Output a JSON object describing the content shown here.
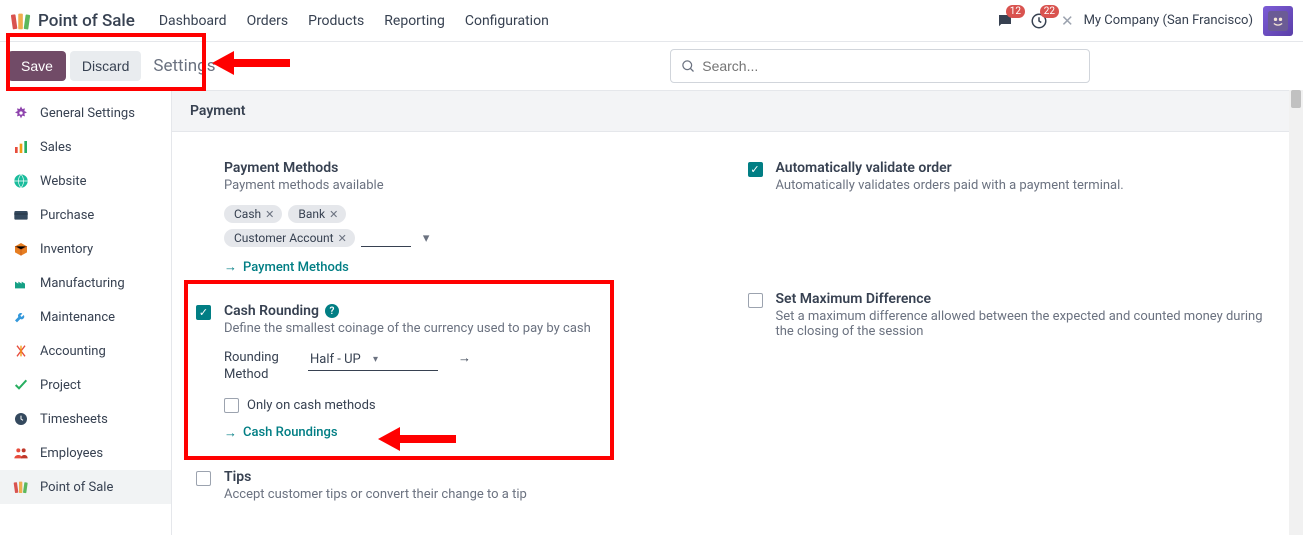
{
  "brand": {
    "title": "Point of Sale"
  },
  "nav": {
    "items": [
      "Dashboard",
      "Orders",
      "Products",
      "Reporting",
      "Configuration"
    ]
  },
  "nav_right": {
    "msg_badge": "12",
    "clock_badge": "22",
    "company": "My Company (San Francisco)"
  },
  "actions": {
    "save": "Save",
    "discard": "Discard",
    "breadcrumb": "Settings"
  },
  "search": {
    "placeholder": "Search..."
  },
  "sidebar": {
    "items": [
      {
        "label": "General Settings",
        "active": false
      },
      {
        "label": "Sales",
        "active": false
      },
      {
        "label": "Website",
        "active": false
      },
      {
        "label": "Purchase",
        "active": false
      },
      {
        "label": "Inventory",
        "active": false
      },
      {
        "label": "Manufacturing",
        "active": false
      },
      {
        "label": "Maintenance",
        "active": false
      },
      {
        "label": "Accounting",
        "active": false
      },
      {
        "label": "Project",
        "active": false
      },
      {
        "label": "Timesheets",
        "active": false
      },
      {
        "label": "Employees",
        "active": false
      },
      {
        "label": "Point of Sale",
        "active": true
      }
    ]
  },
  "section": {
    "title": "Payment"
  },
  "left_col": {
    "payment_methods": {
      "title": "Payment Methods",
      "desc": "Payment methods available",
      "tags": [
        "Cash",
        "Bank",
        "Customer Account"
      ],
      "link": "Payment Methods"
    },
    "cash_rounding": {
      "title": "Cash Rounding",
      "desc": "Define the smallest coinage of the currency used to pay by cash",
      "field_label": "Rounding Method",
      "field_value": "Half - UP",
      "only_cash_label": "Only on cash methods",
      "link": "Cash Roundings"
    },
    "tips": {
      "title": "Tips",
      "desc": "Accept customer tips or convert their change to a tip"
    }
  },
  "right_col": {
    "auto_validate": {
      "title": "Automatically validate order",
      "desc": "Automatically validates orders paid with a payment terminal."
    },
    "max_diff": {
      "title": "Set Maximum Difference",
      "desc": "Set a maximum difference allowed between the expected and counted money during the closing of the session"
    }
  }
}
